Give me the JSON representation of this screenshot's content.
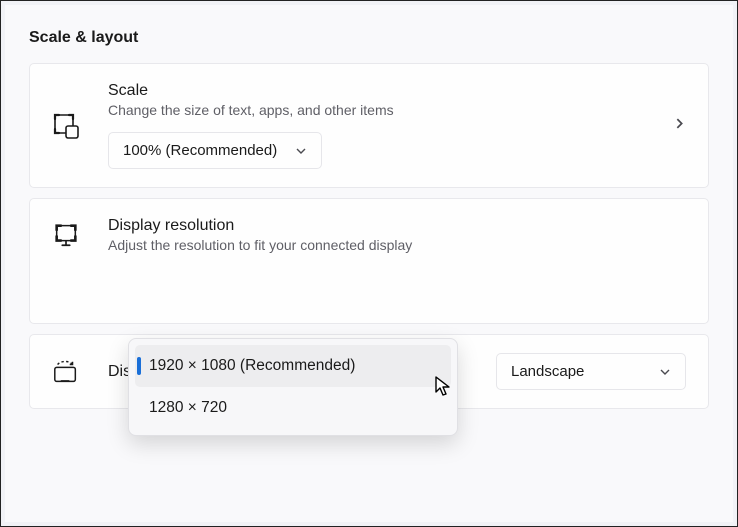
{
  "sectionTitle": "Scale & layout",
  "scale": {
    "title": "Scale",
    "subtitle": "Change the size of text, apps, and other items",
    "selected": "100% (Recommended)"
  },
  "resolution": {
    "title": "Display resolution",
    "subtitle": "Adjust the resolution to fit your connected display",
    "options": [
      "1920 × 1080 (Recommended)",
      "1280 × 720"
    ]
  },
  "orientation": {
    "title": "Display orientation",
    "selected": "Landscape"
  }
}
